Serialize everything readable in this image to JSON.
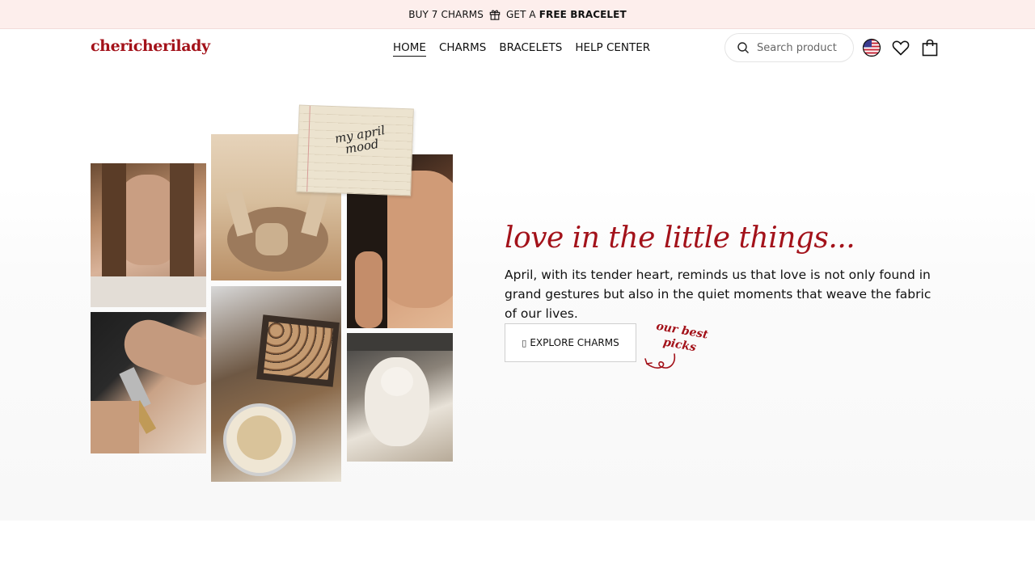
{
  "announcement": {
    "part1": "BUY 7 CHARMS",
    "part2": "GET A",
    "bold": "FREE BRACELET",
    "icon": "gift-icon"
  },
  "header": {
    "logo": "chericherilady",
    "nav": [
      {
        "label": "HOME",
        "active": true
      },
      {
        "label": "CHARMS"
      },
      {
        "label": "BRACELETS"
      },
      {
        "label": "HELP CENTER"
      }
    ],
    "search_placeholder": "Search product",
    "icons": [
      "search-icon",
      "us-flag-icon",
      "heart-icon",
      "bag-icon"
    ]
  },
  "hero": {
    "note_text": "my april mood",
    "headline": "love in the little things...",
    "body": "April, with its tender heart, reminds us that love is not only found in grand gestures but also in the quiet moments that weave the fabric of our lives.",
    "cta_icon": "▯",
    "cta_label": "EXPLORE CHARMS",
    "picks_label": "our best picks"
  },
  "colors": {
    "brand_red": "#a3121a",
    "announce_bg": "#fdeeec"
  }
}
